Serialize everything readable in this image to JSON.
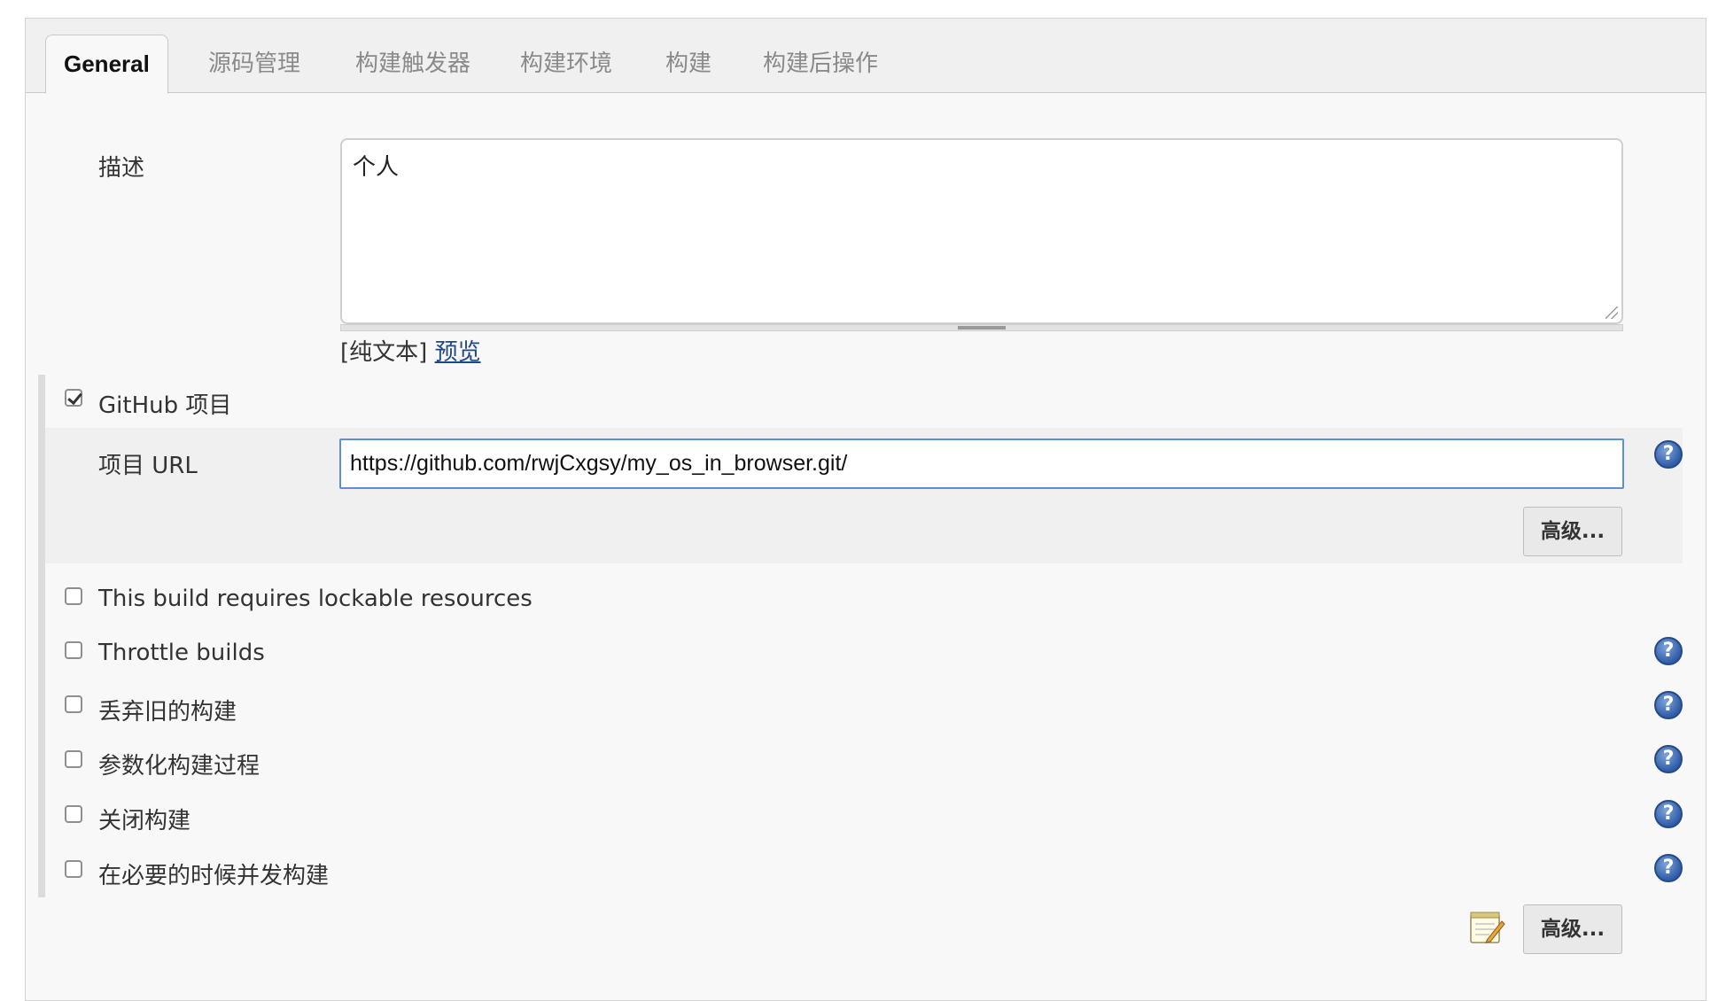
{
  "tabs": [
    {
      "label": "General",
      "active": true
    },
    {
      "label": "源码管理"
    },
    {
      "label": "构建触发器"
    },
    {
      "label": "构建环境"
    },
    {
      "label": "构建"
    },
    {
      "label": "构建后操作"
    }
  ],
  "description": {
    "label": "描述",
    "value": "个人",
    "plain_text": "[纯文本]",
    "preview_link": "预览"
  },
  "github_project": {
    "label": "GitHub 项目",
    "checked": true,
    "url_label": "项目 URL",
    "url_value": "https://github.com/rwjCxgsy/my_os_in_browser.git/",
    "advanced_button": "高级..."
  },
  "options": [
    {
      "label": "This build requires lockable resources",
      "checked": false,
      "has_help": false
    },
    {
      "label": "Throttle builds",
      "checked": false,
      "has_help": true
    },
    {
      "label": "丢弃旧的构建",
      "checked": false,
      "has_help": true
    },
    {
      "label": "参数化构建过程",
      "checked": false,
      "has_help": true
    },
    {
      "label": "关闭构建",
      "checked": false,
      "has_help": true
    },
    {
      "label": "在必要的时候并发构建",
      "checked": false,
      "has_help": true
    }
  ],
  "help_glyph": "?",
  "footer": {
    "advanced_button": "高级...",
    "icon": "notepad-pencil-icon"
  },
  "colors": {
    "link": "#204a87",
    "focus_border": "#5b8fd6",
    "help_icon": "#2f5da8"
  }
}
